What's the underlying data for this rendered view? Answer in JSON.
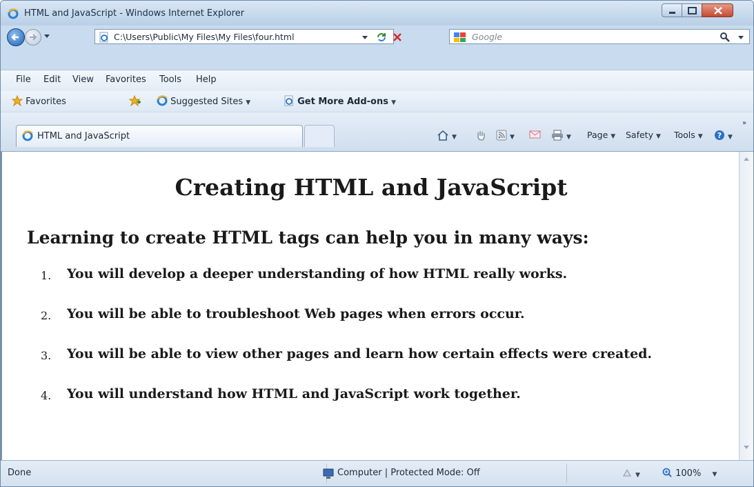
{
  "window": {
    "title": "HTML and JavaScript - Windows Internet Explorer"
  },
  "nav": {
    "address": "C:\\Users\\Public\\My Files\\My Files\\four.html",
    "search_placeholder": "Google"
  },
  "menu": [
    "File",
    "Edit",
    "View",
    "Favorites",
    "Tools",
    "Help"
  ],
  "favorites": {
    "favorites_label": "Favorites",
    "suggested_sites": "Suggested Sites",
    "add_ons": "Get More Add-ons"
  },
  "tab": {
    "label": "HTML and JavaScript"
  },
  "commands": {
    "page": "Page",
    "safety": "Safety",
    "tools": "Tools"
  },
  "page": {
    "title": "Creating HTML and JavaScript",
    "subheading": "Learning to create HTML tags can help you in many ways:",
    "items": [
      {
        "number": "1.",
        "text": "You will develop a deeper understanding of how HTML really works."
      },
      {
        "number": "2.",
        "text": "You will be able to troubleshoot Web pages when errors occur."
      },
      {
        "number": "3.",
        "text": "You will be able to view other pages and learn how certain effects were created."
      },
      {
        "number": "4.",
        "text": "You will understand how HTML and JavaScript work together."
      }
    ]
  },
  "status": {
    "text": "Done",
    "zone": "Computer | Protected Mode: Off",
    "zoom": "100%"
  },
  "icons": [
    "ie-icon",
    "back-icon",
    "forward-icon",
    "refresh-icon",
    "stop-icon",
    "search-icon",
    "star-icon",
    "home-icon",
    "feeds-icon",
    "mail-icon",
    "print-icon",
    "help-icon",
    "computer-icon"
  ],
  "colors": {
    "accent": "#1d5fb6",
    "close": "#c54a32",
    "chrome": "#c9dcef"
  }
}
